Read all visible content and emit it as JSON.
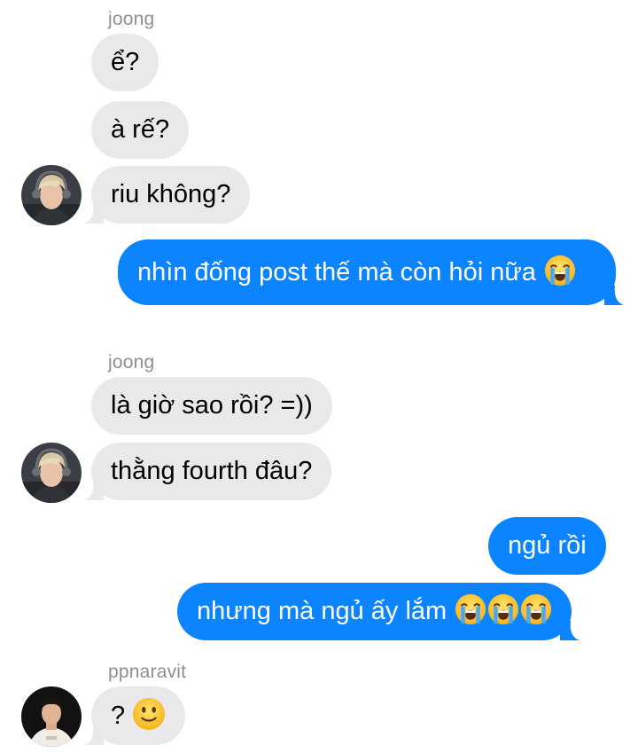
{
  "colors": {
    "incoming_bubble": "#e9e9eb",
    "outgoing_bubble": "#0b84fe",
    "sender_label": "#8e8e93",
    "background": "#ffffff"
  },
  "conversation": [
    {
      "sender": "joong"
    },
    {
      "direction": "incoming",
      "text": "ể?"
    },
    {
      "direction": "incoming",
      "text": "à rế?"
    },
    {
      "direction": "incoming",
      "text": "riu không?",
      "avatar": "joong-avatar"
    },
    {
      "direction": "outgoing",
      "text": "nhìn đống post thế mà còn hỏi nữa",
      "emoji": [
        "loudly-crying-face"
      ]
    },
    {
      "sender": "joong"
    },
    {
      "direction": "incoming",
      "text": "là giờ sao rồi? =))"
    },
    {
      "direction": "incoming",
      "text": "thằng fourth đâu?",
      "avatar": "joong-avatar"
    },
    {
      "direction": "outgoing",
      "text": "ngủ rồi"
    },
    {
      "direction": "outgoing",
      "text": "nhưng mà ngủ ấy lắm",
      "emoji": [
        "loudly-crying-face",
        "loudly-crying-face",
        "loudly-crying-face"
      ]
    },
    {
      "sender": "ppnaravit"
    },
    {
      "direction": "incoming",
      "text": "?",
      "emoji": [
        "slightly-smiling-face"
      ],
      "avatar": "ppnaravit-avatar"
    }
  ]
}
